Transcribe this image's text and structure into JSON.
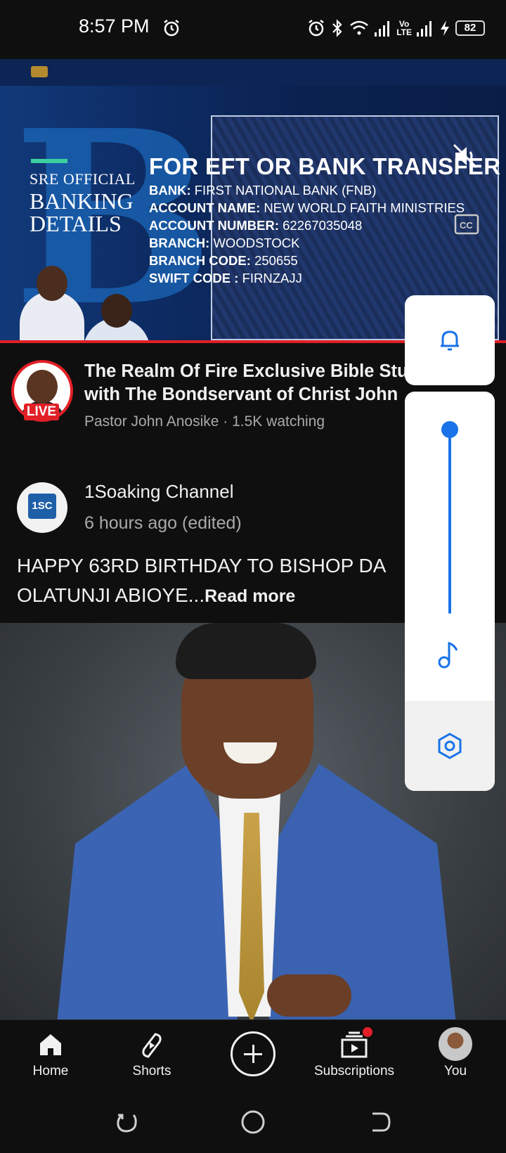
{
  "status_bar": {
    "time": "8:57 PM",
    "battery": "82",
    "icons": [
      "alarm-icon",
      "bluetooth-icon",
      "wifi-icon",
      "signal-icon",
      "volte-icon",
      "signal-icon",
      "charging-icon"
    ],
    "volte_top": "Vo",
    "volte_bottom": "LTE"
  },
  "player": {
    "banner_tag_line1": "SRE OFFICIAL",
    "banner_tag_line2": "BANKING",
    "banner_tag_line3": "DETAILS",
    "bank_title": "FOR EFT OR BANK TRANSFER",
    "bank_lines": [
      {
        "label": "BANK:",
        "value": "FIRST NATIONAL BANK (FNB)"
      },
      {
        "label": "ACCOUNT NAME:",
        "value": "NEW WORLD FAITH MINISTRIES"
      },
      {
        "label": "ACCOUNT NUMBER:",
        "value": "62267035048"
      },
      {
        "label": "BRANCH:",
        "value": "WOODSTOCK"
      },
      {
        "label": "BRANCH CODE:",
        "value": "250655"
      },
      {
        "label": "SWIFT CODE :",
        "value": "FIRNZAJJ"
      }
    ],
    "progress": 1.0
  },
  "live_video": {
    "title_line1": "The Realm Of Fire Exclusive Bible Stu",
    "title_line2": "with The Bondservant of Christ John",
    "live_badge": "LIVE",
    "meta": "Pastor John Anosike · 1.5K watching"
  },
  "post": {
    "channel": "1Soaking Channel",
    "avatar_text": "1SC",
    "time": "6 hours ago (edited)",
    "text_line1": "HAPPY 63RD BIRTHDAY TO BISHOP DA",
    "text_line2": "OLATUNJI ABIOYE...",
    "read_more": "Read more"
  },
  "floating_panel": {
    "buttons": [
      "bell-icon",
      "volume-slider",
      "music-note-icon",
      "settings-icon"
    ],
    "slider_level": 1.0,
    "accent": "#1a73e8"
  },
  "bottom_nav": {
    "items": [
      {
        "label": "Home",
        "icon": "home-icon"
      },
      {
        "label": "Shorts",
        "icon": "shorts-icon"
      },
      {
        "label": "",
        "icon": "create-icon"
      },
      {
        "label": "Subscriptions",
        "icon": "subscriptions-icon"
      },
      {
        "label": "You",
        "icon": "avatar"
      }
    ]
  },
  "system_nav": [
    "recents-button",
    "home-button",
    "back-button"
  ],
  "colors": {
    "background": "#0f0f0f",
    "live_red": "#e21f26",
    "secondary_text": "#aaaaaa"
  }
}
